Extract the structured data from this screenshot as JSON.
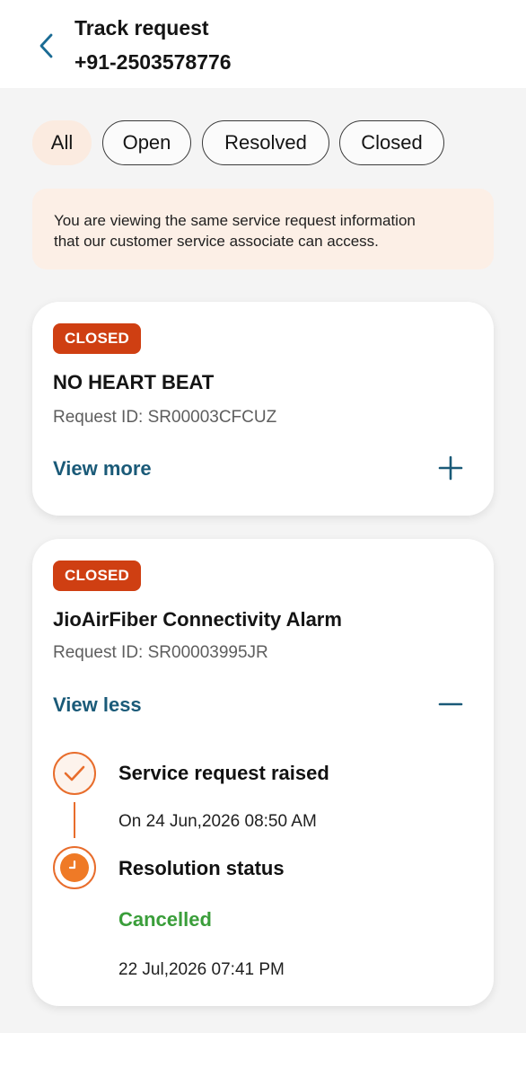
{
  "header": {
    "title": "Track request",
    "phone": "+91-2503578776"
  },
  "filters": [
    {
      "label": "All",
      "active": true
    },
    {
      "label": "Open",
      "active": false
    },
    {
      "label": "Resolved",
      "active": false
    },
    {
      "label": "Closed",
      "active": false
    }
  ],
  "info": {
    "line1": "You are viewing the same service request information",
    "line2": "that our customer service associate can access."
  },
  "requests": [
    {
      "status": "CLOSED",
      "title": "NO HEART BEAT",
      "request_id": "Request ID: SR00003CFCUZ",
      "toggle_label": "View more",
      "toggle_icon": "plus-icon",
      "expanded": false
    },
    {
      "status": "CLOSED",
      "title": "JioAirFiber Connectivity Alarm",
      "request_id": "Request ID: SR00003995JR",
      "toggle_label": "View less",
      "toggle_icon": "minus-icon",
      "expanded": true,
      "timeline": [
        {
          "title": "Service request raised",
          "detail": "On 24 Jun,2026 08:50 AM",
          "icon": "check-icon"
        },
        {
          "title": "Resolution status",
          "status": "Cancelled",
          "detail": "22 Jul,2026 07:41 PM",
          "icon": "clock-icon"
        }
      ]
    }
  ],
  "colors": {
    "accent_orange": "#e86d2c",
    "badge_closed": "#cf3f12",
    "link_blue": "#1a5a78",
    "cancelled_green": "#3a9e3a",
    "info_bg": "#fcefe6"
  }
}
